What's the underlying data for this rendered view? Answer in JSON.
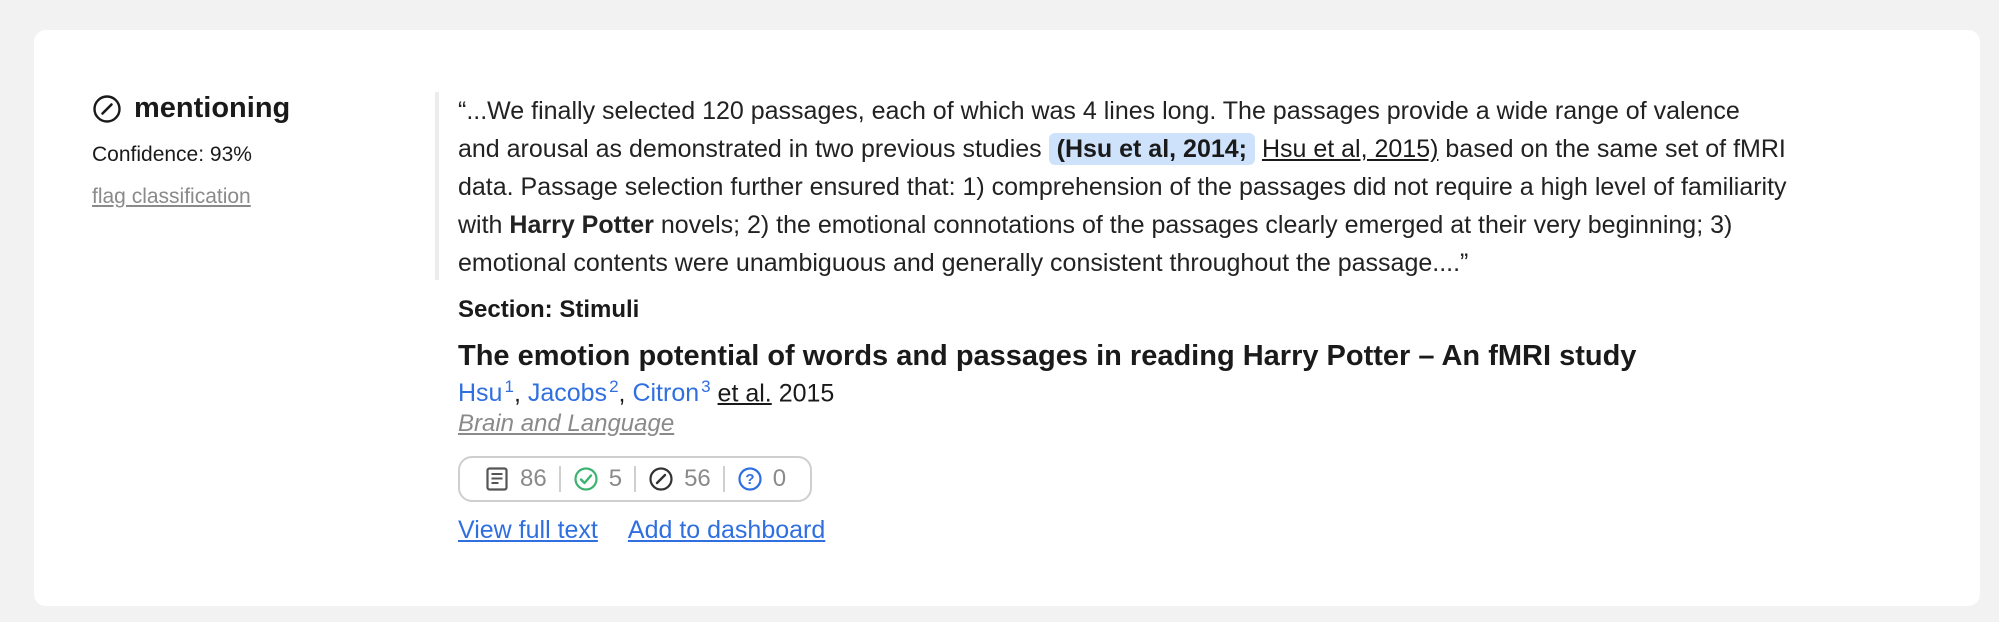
{
  "classification": {
    "type_label": "mentioning",
    "icon": "mentioning-icon",
    "confidence": "Confidence: 93%",
    "flag_label": "flag classification"
  },
  "snippet": {
    "open_quote": "“...We finally selected 120 passages, each of which was 4 lines long. The passages provide a wide range of valence and arousal as demonstrated in two previous studies ",
    "citation_highlight": "(Hsu et al, 2014;",
    "citation_link": "Hsu et al, 2015)",
    "mid_text": " based on the same set of fMRI data. Passage selection further ensured that: 1) comprehension of the passages did not require a high level of familiarity with ",
    "bold_text": "Harry Potter",
    "end_text": " novels; 2) the emotional connotations of the passages clearly emerged at their very beginning; 3) emotional contents were unambiguous and generally consistent throughout the passage....”"
  },
  "section": "Section: Stimuli",
  "paper": {
    "title": "The emotion potential of words and passages in reading Harry Potter – An fMRI study",
    "authors": [
      {
        "name": "Hsu",
        "sup": "1"
      },
      {
        "name": "Jacobs",
        "sup": "2"
      },
      {
        "name": "Citron",
        "sup": "3"
      }
    ],
    "etal": "et al.",
    "year": "2015",
    "journal": "Brain and Language"
  },
  "counts": {
    "citing": "86",
    "supporting": "5",
    "mentioning": "56",
    "contrasting": "0"
  },
  "colors": {
    "link_blue": "#2f6fe0",
    "supporting_green": "#3cb371",
    "highlight_bg": "#cfe2fb"
  },
  "actions": {
    "view_full_text": "View full text",
    "add_to_dashboard": "Add to dashboard"
  }
}
